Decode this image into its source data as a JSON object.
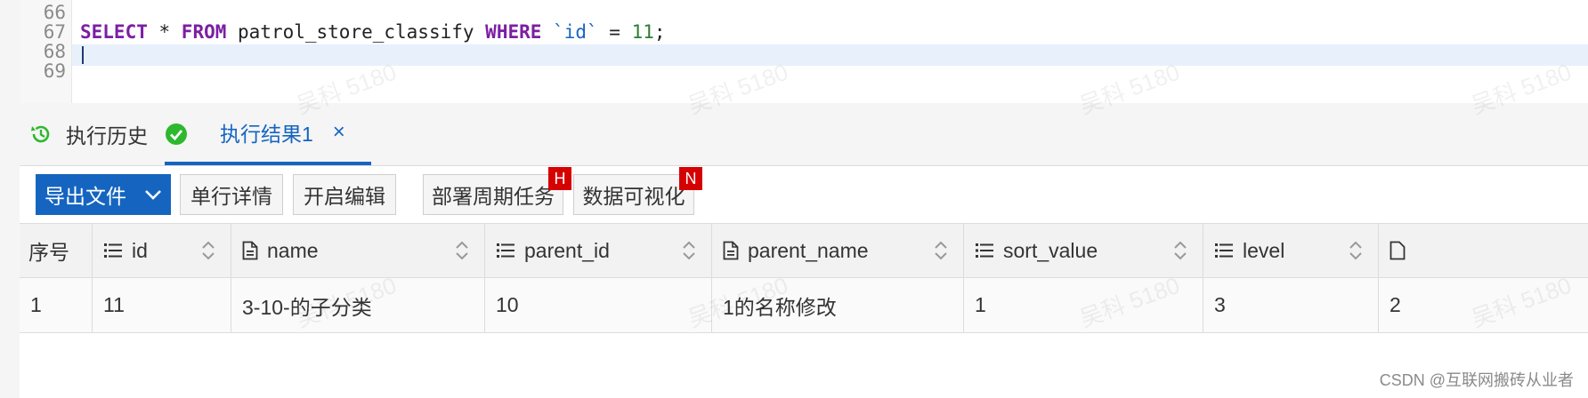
{
  "editor": {
    "line_numbers": [
      "66",
      "67",
      "68",
      "69"
    ],
    "code_lines": [
      {
        "kw1": "SELECT",
        "t1": " * ",
        "kw2": "FROM",
        "t2": " patrol_store_classify ",
        "kw3": "WHERE",
        "t3": " ",
        "ident": "`id`",
        "t4": " = ",
        "num": "11",
        "t5": ";"
      }
    ]
  },
  "tabs": {
    "history_label": "执行历史",
    "result_label": "执行结果1",
    "close_label": "×"
  },
  "toolbar": {
    "export_label": "导出文件",
    "row_detail_label": "单行详情",
    "edit_label": "开启编辑",
    "deploy_label": "部署周期任务",
    "deploy_badge": "H",
    "visualize_label": "数据可视化",
    "visualize_badge": "N"
  },
  "grid": {
    "columns": [
      {
        "label": "序号",
        "icon": "none"
      },
      {
        "label": "id",
        "icon": "list-icon"
      },
      {
        "label": "name",
        "icon": "document-icon"
      },
      {
        "label": "parent_id",
        "icon": "list-icon"
      },
      {
        "label": "parent_name",
        "icon": "document-icon"
      },
      {
        "label": "sort_value",
        "icon": "list-icon"
      },
      {
        "label": "level",
        "icon": "list-icon"
      }
    ],
    "rows": [
      [
        "1",
        "11",
        "3-10-的子分类",
        "10",
        "1的名称修改",
        "1",
        "3",
        "2"
      ]
    ]
  },
  "watermark": "吴科 5180",
  "credit": "CSDN @互联网搬砖从业者",
  "colors": {
    "accent": "#1565c0",
    "badge": "#d50000",
    "success": "#2eb82e",
    "keyword": "#7b1fa2"
  }
}
